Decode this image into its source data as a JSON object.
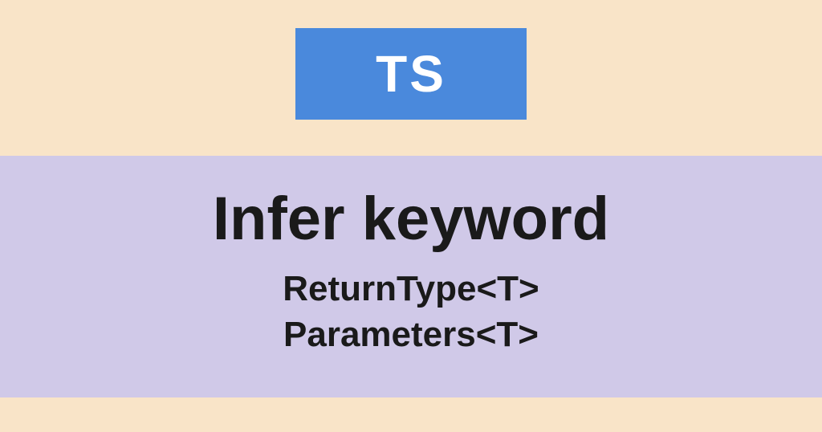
{
  "badge": {
    "label": "TS"
  },
  "content": {
    "title": "Infer keyword",
    "subtitle1": "ReturnType<T>",
    "subtitle2": "Parameters<T>"
  }
}
